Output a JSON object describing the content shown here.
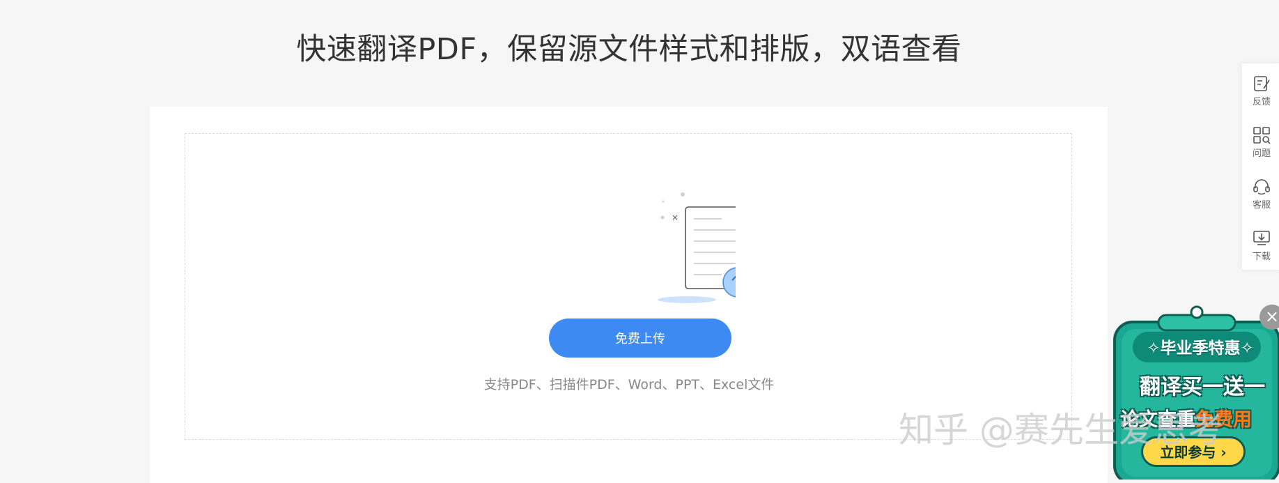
{
  "page": {
    "headline": "快速翻译PDF，保留源文件样式和排版，双语查看"
  },
  "upload": {
    "button_label": "免费上传",
    "hint": "支持PDF、扫描件PDF、Word、PPT、Excel文件"
  },
  "sidebar": {
    "items": [
      {
        "label": "反馈",
        "icon": "feedback-icon"
      },
      {
        "label": "问题",
        "icon": "grid-search-icon"
      },
      {
        "label": "客服",
        "icon": "headset-icon"
      },
      {
        "label": "下载",
        "icon": "download-icon"
      }
    ]
  },
  "promo": {
    "title": "✧毕业季特惠✧",
    "line1": "翻译买一送一",
    "line2_prefix": "论文查重",
    "line2_highlight": "免费用",
    "cta": "立即参与 ›",
    "close": "×"
  },
  "watermark": {
    "text": "知乎 @赛先生爱思考"
  },
  "colors": {
    "accent": "#3d8bf2",
    "background": "#f6f6f6",
    "promo_green": "#1aa893"
  }
}
